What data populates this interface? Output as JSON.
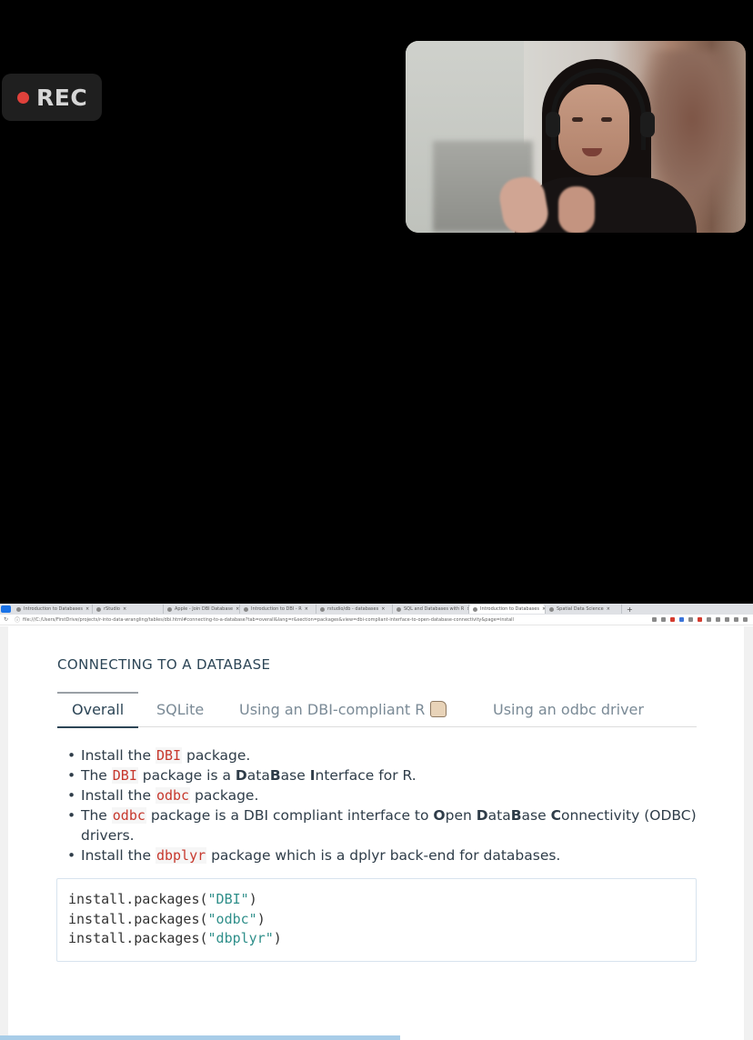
{
  "recording": {
    "label": "REC",
    "dot_color": "#e0413b"
  },
  "video": {
    "description_icon": "participant-video-icon"
  },
  "browser": {
    "tabs": [
      {
        "label": "Introduction to Databases",
        "active": false
      },
      {
        "label": "rStudio",
        "active": false
      },
      {
        "label": "Apple - Join DBI Database",
        "active": false
      },
      {
        "label": "Introduction to DBI - R",
        "active": false
      },
      {
        "label": "rstudio/db - databases",
        "active": false
      },
      {
        "label": "SQL and Databases with R",
        "active": false
      },
      {
        "label": "Introduction to Databases",
        "active": true
      },
      {
        "label": "Spatial Data Science",
        "active": false
      }
    ],
    "new_tab": "+",
    "url": "file:///C:/Users/FirstDrive/projects/r-into-data-wrangling/tables/dbi.html#connecting-to-a-database?tab=overall&lang=r&section=packages&view=dbi-compliant-interface-to-open-database-connectivity&page=install"
  },
  "page": {
    "heading": "CONNECTING TO A DATABASE",
    "tabs": [
      "Overall",
      "SQLite",
      "Using an DBI-compliant R",
      "Using an odbc driver"
    ],
    "bullets": [
      {
        "pre": "Install the ",
        "code": "DBI",
        "post": " package."
      },
      {
        "pre": "The ",
        "code": "DBI",
        "mid": " package is a ",
        "b1": "D",
        "t1": "ata",
        "b2": "B",
        "t2": "ase ",
        "b3": "I",
        "t3": "nterface for R."
      },
      {
        "pre": "Install the ",
        "code": "odbc",
        "post": " package."
      },
      {
        "pre": "The ",
        "code": "odbc",
        "mid": " package is a DBI compliant interface to ",
        "b1": "O",
        "t1": "pen ",
        "b2": "D",
        "t2": "ata",
        "b3": "B",
        "t3": "ase ",
        "b4": "C",
        "t4": "onnectivity (ODBC) drivers."
      },
      {
        "pre": "Install the ",
        "code": "dbplyr",
        "post": " package which is a dplyr back-end for databases."
      }
    ],
    "code_lines": [
      {
        "fn": "install.packages(",
        "arg": "\"DBI\"",
        "close": ")"
      },
      {
        "fn": "install.packages(",
        "arg": "\"odbc\"",
        "close": ")"
      },
      {
        "fn": "install.packages(",
        "arg": "\"dbplyr\"",
        "close": ")"
      }
    ]
  },
  "colors": {
    "inline_code": "#c7382d",
    "string": "#2f8f8a",
    "heading": "#2c4556"
  }
}
